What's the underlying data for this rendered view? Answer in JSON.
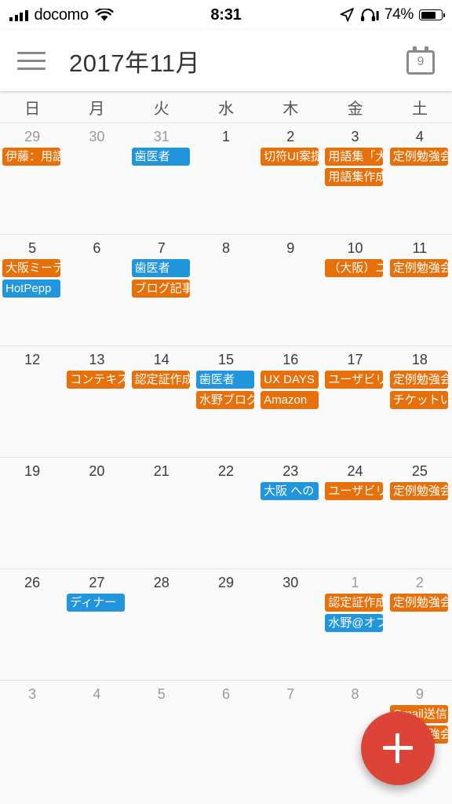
{
  "status_bar": {
    "carrier": "docomo",
    "signal_icon": "signal-bars-icon",
    "wifi_icon": "wifi-icon",
    "time": "8:31",
    "location_icon": "location-arrow-icon",
    "headphones_icon": "headphones-icon",
    "battery_percent": "74%",
    "battery_icon": "battery-icon"
  },
  "app_bar": {
    "menu_icon": "hamburger-menu-icon",
    "title": "2017年11月",
    "today_icon": "calendar-today-icon",
    "today_icon_number": "9"
  },
  "weekdays": [
    "日",
    "月",
    "火",
    "水",
    "木",
    "金",
    "土"
  ],
  "colors": {
    "event_orange": "#e8700a",
    "event_blue": "#2196dd",
    "fab_red": "#db4437",
    "background": "#fafafa",
    "grid_line": "#e2e2e2"
  },
  "fab": {
    "label": "+",
    "name": "add-event-button"
  },
  "weeks": [
    {
      "days": [
        {
          "num": "29",
          "out": true,
          "events": [
            {
              "text": "伊藤：用語",
              "color": "orange"
            }
          ]
        },
        {
          "num": "30",
          "out": true,
          "events": []
        },
        {
          "num": "31",
          "out": true,
          "events": [
            {
              "text": "歯医者",
              "color": "blue"
            }
          ]
        },
        {
          "num": "1",
          "out": false,
          "events": []
        },
        {
          "num": "2",
          "out": false,
          "events": [
            {
              "text": "切符UI案提",
              "color": "orange"
            }
          ]
        },
        {
          "num": "3",
          "out": false,
          "events": [
            {
              "text": "用語集「大",
              "color": "orange"
            },
            {
              "text": "用語集作成",
              "color": "orange"
            }
          ]
        },
        {
          "num": "4",
          "out": false,
          "events": [
            {
              "text": "定例勉強会",
              "color": "orange"
            }
          ]
        }
      ]
    },
    {
      "days": [
        {
          "num": "5",
          "out": false,
          "events": [
            {
              "text": "大阪ミーテ",
              "color": "orange"
            },
            {
              "text": "HotPepp",
              "color": "blue"
            }
          ]
        },
        {
          "num": "6",
          "out": false,
          "events": []
        },
        {
          "num": "7",
          "out": false,
          "events": [
            {
              "text": "歯医者",
              "color": "blue"
            },
            {
              "text": "ブログ記事",
              "color": "orange"
            }
          ]
        },
        {
          "num": "8",
          "out": false,
          "events": []
        },
        {
          "num": "9",
          "out": false,
          "events": []
        },
        {
          "num": "10",
          "out": false,
          "events": [
            {
              "text": "（大阪）ユ",
              "color": "orange"
            }
          ]
        },
        {
          "num": "11",
          "out": false,
          "events": [
            {
              "text": "定例勉強会",
              "color": "orange"
            }
          ]
        }
      ]
    },
    {
      "days": [
        {
          "num": "12",
          "out": false,
          "events": []
        },
        {
          "num": "13",
          "out": false,
          "events": [
            {
              "text": "コンテキス",
              "color": "orange"
            }
          ]
        },
        {
          "num": "14",
          "out": false,
          "events": [
            {
              "text": "認定証作成",
              "color": "orange"
            }
          ]
        },
        {
          "num": "15",
          "out": false,
          "events": [
            {
              "text": "歯医者",
              "color": "blue"
            },
            {
              "text": "水野ブログ",
              "color": "orange"
            }
          ]
        },
        {
          "num": "16",
          "out": false,
          "events": [
            {
              "text": "UX DAYS",
              "color": "orange"
            },
            {
              "text": "Amazon",
              "color": "orange"
            }
          ]
        },
        {
          "num": "17",
          "out": false,
          "events": [
            {
              "text": "ユーザビリ",
              "color": "orange"
            }
          ]
        },
        {
          "num": "18",
          "out": false,
          "events": [
            {
              "text": "定例勉強会",
              "color": "orange"
            },
            {
              "text": "チケットい",
              "color": "orange"
            }
          ]
        }
      ]
    },
    {
      "days": [
        {
          "num": "19",
          "out": false,
          "events": []
        },
        {
          "num": "20",
          "out": false,
          "events": []
        },
        {
          "num": "21",
          "out": false,
          "events": []
        },
        {
          "num": "22",
          "out": false,
          "events": []
        },
        {
          "num": "23",
          "out": false,
          "events": [
            {
              "text": "大阪 への",
              "color": "blue"
            }
          ]
        },
        {
          "num": "24",
          "out": false,
          "events": [
            {
              "text": "ユーザビリ",
              "color": "orange"
            }
          ]
        },
        {
          "num": "25",
          "out": false,
          "events": [
            {
              "text": "定例勉強会",
              "color": "orange"
            }
          ]
        }
      ]
    },
    {
      "days": [
        {
          "num": "26",
          "out": false,
          "events": []
        },
        {
          "num": "27",
          "out": false,
          "events": [
            {
              "text": "ディナー",
              "color": "blue"
            }
          ]
        },
        {
          "num": "28",
          "out": false,
          "events": []
        },
        {
          "num": "29",
          "out": false,
          "events": []
        },
        {
          "num": "30",
          "out": false,
          "events": []
        },
        {
          "num": "1",
          "out": true,
          "events": [
            {
              "text": "認定証作成",
              "color": "orange"
            },
            {
              "text": "水野@オフ",
              "color": "blue"
            }
          ]
        },
        {
          "num": "2",
          "out": true,
          "events": [
            {
              "text": "定例勉強会",
              "color": "orange"
            }
          ]
        }
      ]
    },
    {
      "days": [
        {
          "num": "3",
          "out": true,
          "events": []
        },
        {
          "num": "4",
          "out": true,
          "events": []
        },
        {
          "num": "5",
          "out": true,
          "events": []
        },
        {
          "num": "6",
          "out": true,
          "events": []
        },
        {
          "num": "7",
          "out": true,
          "events": []
        },
        {
          "num": "8",
          "out": true,
          "events": []
        },
        {
          "num": "9",
          "out": true,
          "events": [
            {
              "text": "Gmail送信",
              "color": "orange"
            },
            {
              "text": "定例勉強会",
              "color": "orange"
            }
          ]
        }
      ]
    }
  ]
}
